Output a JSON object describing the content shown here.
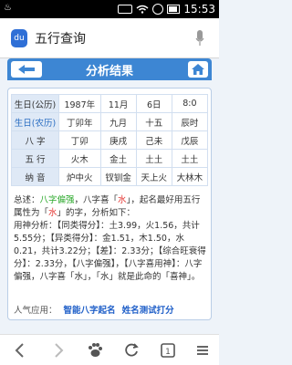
{
  "status": {
    "time": "15:53"
  },
  "search": {
    "query": "五行查询"
  },
  "header": {
    "title": "分析结果"
  },
  "table": {
    "rows": [
      [
        "生日(公历)",
        "1987年",
        "11月",
        "6日",
        "8:0"
      ],
      [
        "生日(农历)",
        "丁卯年",
        "九月",
        "十五",
        "辰时"
      ],
      [
        "八 字",
        "丁卯",
        "庚戌",
        "己未",
        "戊辰"
      ],
      [
        "五 行",
        "火木",
        "金土",
        "土土",
        "土土"
      ],
      [
        "纳 音",
        "炉中火",
        "钗钏金",
        "天上火",
        "大林木"
      ]
    ]
  },
  "summary": {
    "p1_a": "总述：",
    "p1_b": "八字偏强",
    "p1_c": "，八字喜「",
    "p1_d": "水",
    "p1_e": "」，起名最好用五行属性为「",
    "p1_f": "水",
    "p1_g": "」的字，分析如下：",
    "p2": "用神分析：【同类得分】：土3.99，火1.56，共计5.55分；【异类得分】：金1.51，木1.50，水0.21，共计3.22分；【差】：2.33分；【综合旺衰得分】：2.33分，【八字偏强】，【八字喜用神】：八字偏强，八字喜「水」，「水」就是此命的「喜神」。"
  },
  "links": {
    "label": "人气应用：",
    "item1": "智能八字起名",
    "item2": "姓名测试打分"
  },
  "colors": {
    "accent": "#3d86d3",
    "highlight_green": "#2aa82a",
    "highlight_red": "#e53935",
    "link": "#1f5fc8"
  }
}
